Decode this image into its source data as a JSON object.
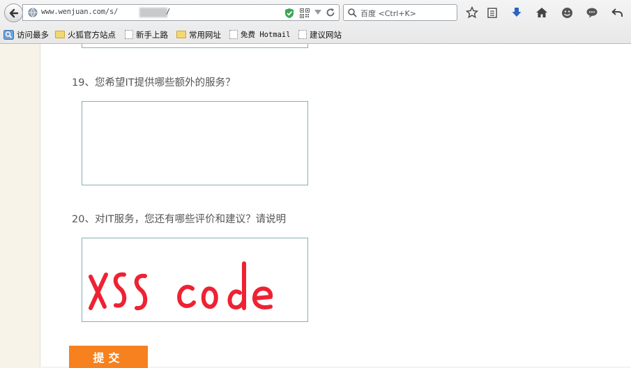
{
  "browser": {
    "url_visible": "www.wenjuan.com/s/",
    "url_trailing": "/",
    "search_placeholder": "百度 <Ctrl+K>"
  },
  "bookmarks": [
    {
      "label": "访问最多",
      "icon": "most-visited-icon"
    },
    {
      "label": "火狐官方站点",
      "icon": "folder-icon"
    },
    {
      "label": "新手上路",
      "icon": "page-icon"
    },
    {
      "label": "常用网址",
      "icon": "folder-icon"
    },
    {
      "label": "免费 Hotmail",
      "icon": "page-icon"
    },
    {
      "label": "建议网站",
      "icon": "page-icon"
    }
  ],
  "questions": [
    {
      "number": "19",
      "text": "19、您希望IT提供哪些额外的服务？",
      "answer": ""
    },
    {
      "number": "20",
      "text": "20、对IT服务，您还有哪些评价和建议？请说明",
      "answer_handwriting": "XSS code"
    }
  ],
  "submit_label": "提交",
  "colors": {
    "accent": "#f6811e",
    "box_border": "#86afb0",
    "handwriting": "#ee2233",
    "page_bg": "#f7f3e8"
  }
}
